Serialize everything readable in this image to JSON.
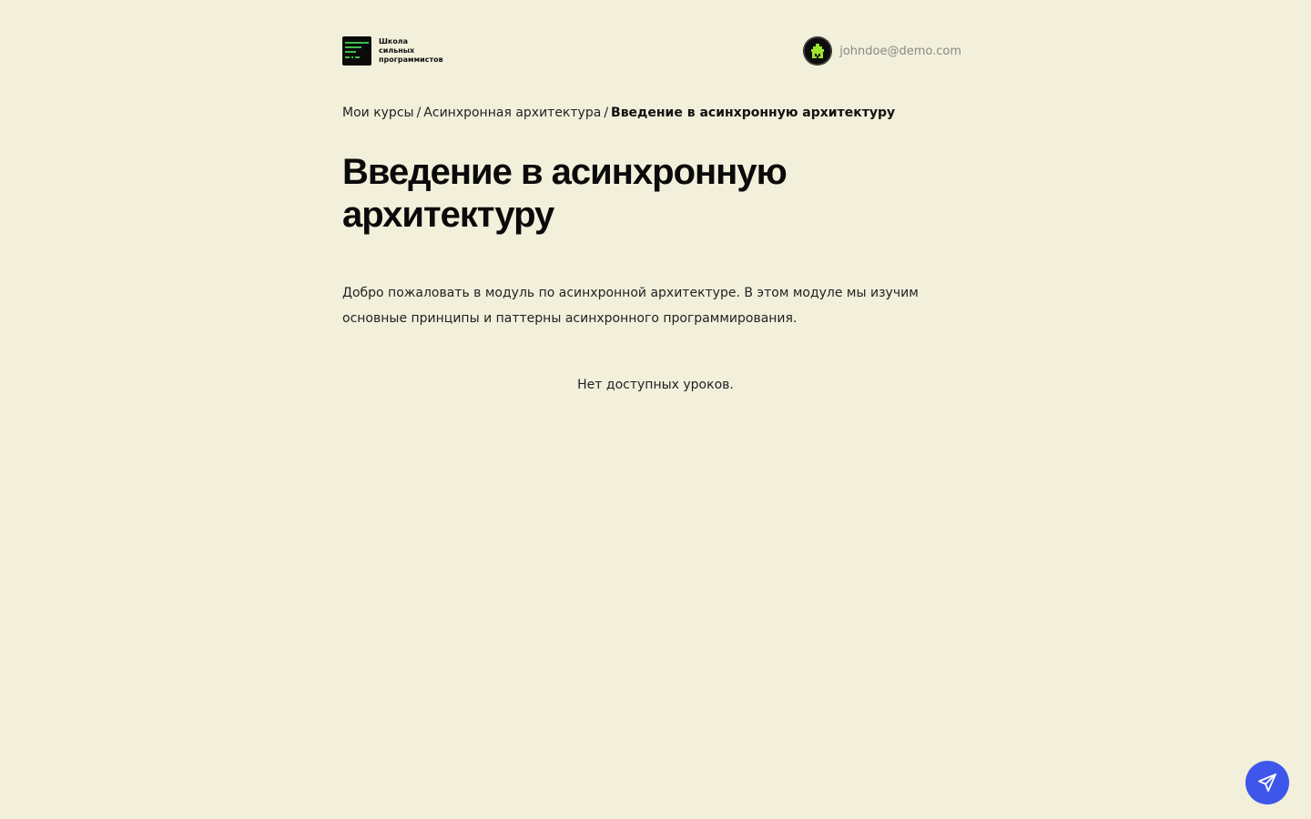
{
  "header": {
    "logo": {
      "line1": "Школа",
      "line2": "сильных",
      "line3": "программистов",
      "icon": "terminal-lines-logo"
    },
    "user": {
      "email": "johndoe@demo.com",
      "avatar_icon": "pixel-house-avatar"
    }
  },
  "breadcrumb": {
    "items": [
      "Мои курсы",
      "Асинхронная архитектура"
    ],
    "separator": "/",
    "current": "Введение в асинхронную архитектуру"
  },
  "module": {
    "title": "Введение в асинхронную архитектуру",
    "description": "Добро пожаловать в модуль по асинхронной архитектуре. В этом модуле мы изучим основные принципы и паттерны асинхронного программирования.",
    "empty_state": "Нет доступных уроков."
  },
  "chat_button": {
    "icon": "paper-plane-icon"
  },
  "colors": {
    "background": "#f2efdb",
    "text": "#111111",
    "muted": "#8a8a84",
    "accent_green": "#3fbf4a",
    "avatar_green": "#9be52d",
    "chat_button": "#3e57ea"
  }
}
